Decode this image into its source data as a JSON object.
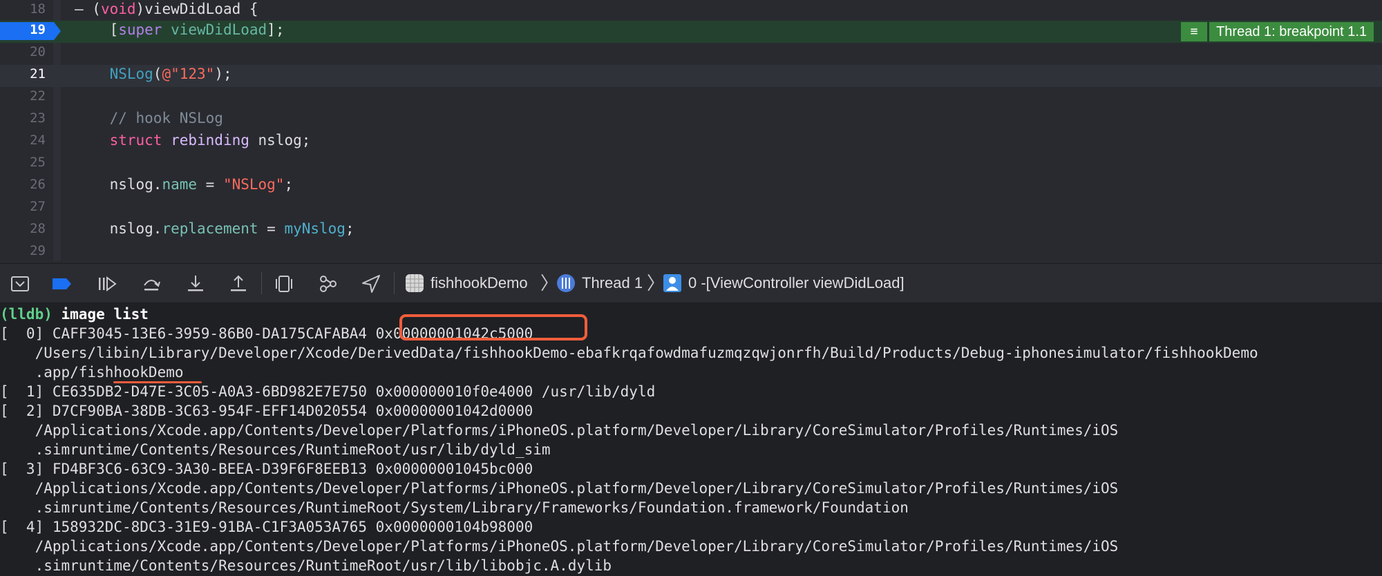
{
  "editor": {
    "lines": [
      {
        "num": "18",
        "tokens": [
          [
            "pl",
            "– ("
          ],
          [
            "kw",
            "void"
          ],
          [
            "pl",
            ")viewDidLoad {"
          ]
        ]
      },
      {
        "num": "19",
        "tokens": [
          [
            "pl",
            "    ["
          ],
          [
            "sup",
            "super"
          ],
          [
            "pl",
            " "
          ],
          [
            "meth",
            "viewDidLoad"
          ],
          [
            "pl",
            "];"
          ]
        ]
      },
      {
        "num": "20",
        "tokens": []
      },
      {
        "num": "21",
        "tokens": [
          [
            "pl",
            "    "
          ],
          [
            "fn",
            "NSLog"
          ],
          [
            "pl",
            "("
          ],
          [
            "str",
            "@\"123\""
          ],
          [
            "pl",
            ");"
          ]
        ]
      },
      {
        "num": "22",
        "tokens": []
      },
      {
        "num": "23",
        "tokens": [
          [
            "cmt",
            "    // hook NSLog"
          ]
        ]
      },
      {
        "num": "24",
        "tokens": [
          [
            "pl",
            "    "
          ],
          [
            "kw",
            "struct"
          ],
          [
            "pl",
            " "
          ],
          [
            "ty",
            "rebinding"
          ],
          [
            "pl",
            " nslog;"
          ]
        ]
      },
      {
        "num": "25",
        "tokens": []
      },
      {
        "num": "26",
        "tokens": [
          [
            "pl",
            "    nslog."
          ],
          [
            "prop",
            "name"
          ],
          [
            "pl",
            " = "
          ],
          [
            "str",
            "\"NSLog\""
          ],
          [
            "pl",
            ";"
          ]
        ]
      },
      {
        "num": "27",
        "tokens": []
      },
      {
        "num": "28",
        "tokens": [
          [
            "pl",
            "    nslog."
          ],
          [
            "prop",
            "replacement"
          ],
          [
            "pl",
            " = "
          ],
          [
            "usr",
            "myNslog"
          ],
          [
            "pl",
            ";"
          ]
        ]
      },
      {
        "num": "29",
        "tokens": []
      }
    ],
    "thread_badge": {
      "icon": "≡",
      "label": "Thread 1: breakpoint 1.1"
    }
  },
  "toolbar": {
    "icons": [
      "hide-debug-area-icon",
      "breakpoints-toggle-icon",
      "continue-icon",
      "step-over-icon",
      "step-into-icon",
      "step-out-icon",
      "view-hierarchy-icon",
      "memory-graph-icon",
      "simulate-location-icon"
    ],
    "breadcrumb": {
      "target": "fishhookDemo",
      "thread": "Thread 1",
      "frame": "0 -[ViewController viewDidLoad]"
    }
  },
  "console": {
    "prompt": "(lldb)",
    "command": " image list",
    "lines": [
      "[  0] CAFF3045-13E6-3959-86B0-DA175CAFABA4 0x00000001042c5000",
      "    /Users/libin/Library/Developer/Xcode/DerivedData/fishhookDemo-ebafkrqafowdmafuzmqzqwjonrfh/Build/Products/Debug-iphonesimulator/fishhookDemo",
      "    .app/fishhookDemo",
      "[  1] CE635DB2-D47E-3C05-A0A3-6BD982E7E750 0x000000010f0e4000 /usr/lib/dyld",
      "[  2] D7CF90BA-38DB-3C63-954F-EFF14D020554 0x00000001042d0000",
      "    /Applications/Xcode.app/Contents/Developer/Platforms/iPhoneOS.platform/Developer/Library/CoreSimulator/Profiles/Runtimes/iOS",
      "    .simruntime/Contents/Resources/RuntimeRoot/usr/lib/dyld_sim",
      "[  3] FD4BF3C6-63C9-3A30-BEEA-D39F6F8EEB13 0x00000001045bc000",
      "    /Applications/Xcode.app/Contents/Developer/Platforms/iPhoneOS.platform/Developer/Library/CoreSimulator/Profiles/Runtimes/iOS",
      "    .simruntime/Contents/Resources/RuntimeRoot/System/Library/Frameworks/Foundation.framework/Foundation",
      "[  4] 158932DC-8DC3-31E9-91BA-C1F3A053A765 0x0000000104b98000",
      "    /Applications/Xcode.app/Contents/Developer/Platforms/iPhoneOS.platform/Developer/Library/CoreSimulator/Profiles/Runtimes/iOS",
      "    .simruntime/Contents/Resources/RuntimeRoot/usr/lib/libobjc.A.dylib"
    ]
  },
  "colors": {
    "breakpoint": "#1a6ff2",
    "thread_badge": "#3c8c3f",
    "annotation": "#f05d3b",
    "prompt": "#5fd08b"
  }
}
